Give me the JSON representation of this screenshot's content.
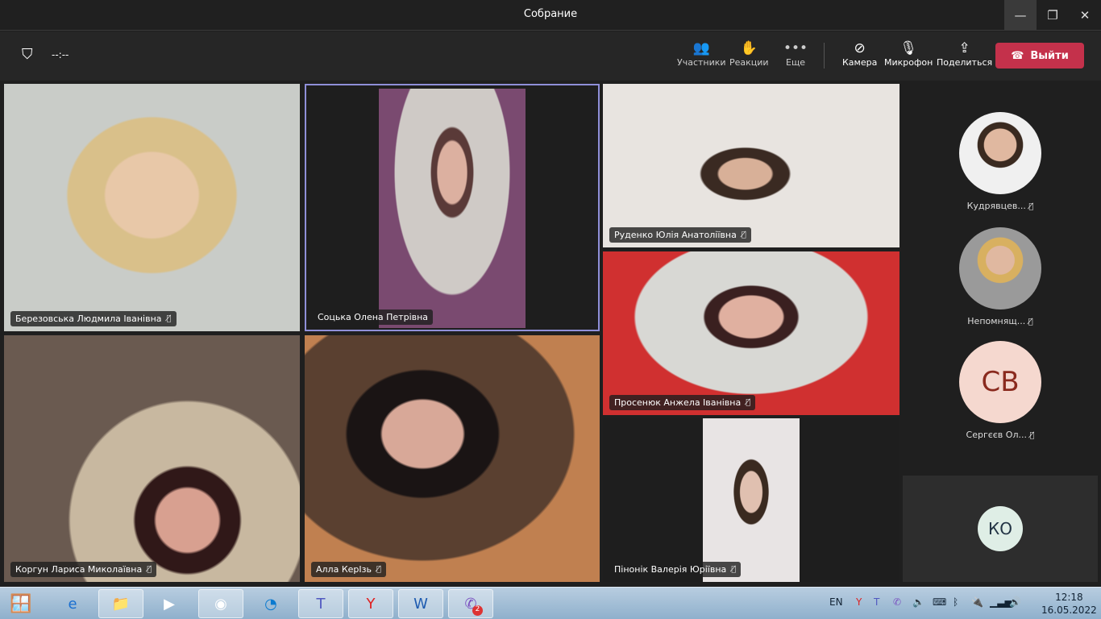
{
  "window": {
    "title": "Собрание"
  },
  "toolbar": {
    "timer": "--:--",
    "participants": "Участники",
    "reactions": "Реакции",
    "more": "Еще",
    "camera": "Камера",
    "mic": "Микрофон",
    "share": "Поделиться",
    "leave": "Выйти",
    "leave_color": "#c4314b"
  },
  "tiles": [
    {
      "name": "Березовська Людмила Іванівна"
    },
    {
      "name": "Соцька Олена Петрівна"
    },
    {
      "name": "Руденко Юлія Анатоліївна"
    },
    {
      "name": "Просенюк Анжела Іванівна"
    },
    {
      "name": "Пінонік Валерія Юріївна"
    },
    {
      "name": "Коргун Лариса Миколаївна"
    },
    {
      "name": "Алла КерІзь"
    }
  ],
  "side": [
    {
      "name": "Кудрявцев..."
    },
    {
      "name": "Непомнящ..."
    },
    {
      "name": "Сергєєв Ол...",
      "initials": "СВ"
    }
  ],
  "self_tile": {
    "initials": "КО"
  },
  "taskbar": {
    "lang": "EN",
    "time": "12:18",
    "date": "16.05.2022",
    "viber_badge": "2"
  }
}
